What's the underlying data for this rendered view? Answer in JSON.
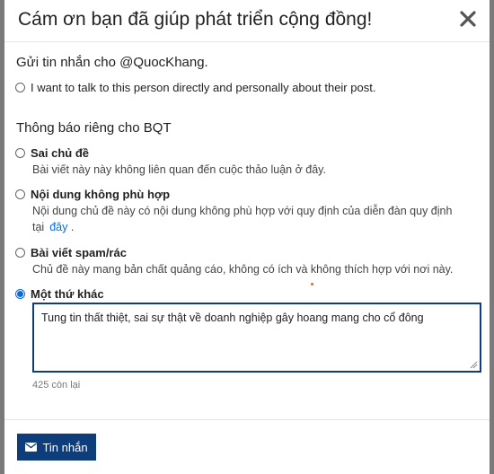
{
  "modal": {
    "title": "Cám ơn bạn đã giúp phát triển cộng đồng!"
  },
  "message_section": {
    "heading": "Gửi tin nhắn cho @QuocKhang.",
    "option_label": "I want to talk to this person directly and personally about their post."
  },
  "private_section": {
    "heading": "Thông báo riêng cho BQT",
    "options": [
      {
        "title": "Sai chủ đề",
        "desc": "Bài viết này này không liên quan đến cuộc thảo luận ở đây."
      },
      {
        "title": "Nội dung không phù hợp",
        "desc_line1": "Nội dung chủ đề này có nội dung không phù hợp với quy định của diễn đàn quy định",
        "desc_line2": "tại",
        "link": "đây",
        "desc_end": "."
      },
      {
        "title": "Bài viết spam/rác",
        "desc": "Chủ đề này mang bản chất quảng cáo, không có ích và không thích hợp với nơi này."
      },
      {
        "title": "Một thứ khác",
        "selected": true
      }
    ]
  },
  "textarea": {
    "value": "Tung tin thất thiệt, sai sự thật về doanh nghiệp gây hoang mang cho cổ đông"
  },
  "remaining": "425 còn lại",
  "footer": {
    "submit_label": "Tin nhắn",
    "submit_icon": "envelope-icon"
  },
  "colors": {
    "primary": "#0d3d7a",
    "link": "#0a6cd8"
  }
}
